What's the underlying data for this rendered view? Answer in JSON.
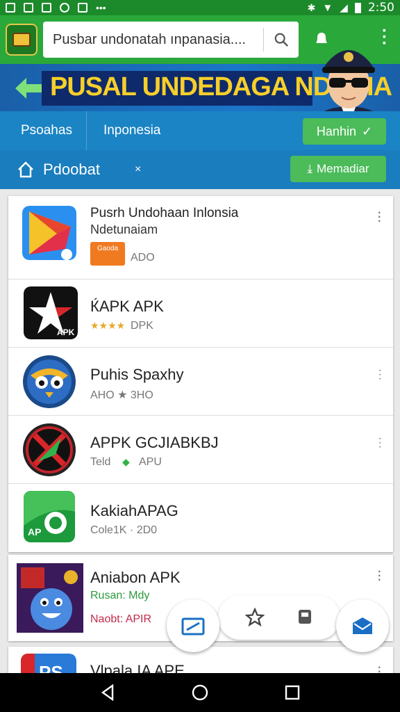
{
  "status_bar": {
    "time": "2:50"
  },
  "search": {
    "value": "Pusbar undonatah ınpanasia...."
  },
  "banner": {
    "text": "PUSAL UNDEDAGA NDNSIA"
  },
  "categories": {
    "items": [
      "Psoahas",
      "Inponesia"
    ],
    "pill": "Hanhin"
  },
  "subheader": {
    "label": "Pdoobat",
    "x": "×",
    "download": "Memadiar"
  },
  "apps": [
    {
      "title": "Pusrh Undohaan Inlonsia",
      "subtitle": "Ndetunaiam",
      "meta": "ADO",
      "badge": "Gaoda"
    },
    {
      "title": "ЌAPK  APK",
      "meta": "DPK",
      "stars": "★★★★"
    },
    {
      "title": "Puhis Spaxhy",
      "meta": "AHO ★ 3HO"
    },
    {
      "title": "APPK GCJIABKBJ",
      "meta": "Teld",
      "meta2": "APU"
    },
    {
      "title": "KakiahAPAG",
      "meta": "Cole1K · 2D0"
    }
  ],
  "apps2": [
    {
      "title": "Aniabon APK",
      "line1": "Rusan: Mdy",
      "line2": "Naobt: APIR"
    }
  ],
  "apps3": [
    {
      "title": "Vlpala IA APE"
    }
  ],
  "colors": {
    "primary": "#2aa83a",
    "status": "#1c8a2a",
    "banner": "#1b76c9",
    "accent": "#4cbb5a"
  }
}
